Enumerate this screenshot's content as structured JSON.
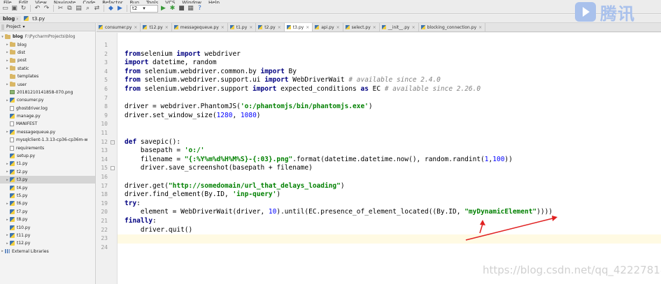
{
  "menu": [
    "File",
    "Edit",
    "View",
    "Navigate",
    "Code",
    "Refactor",
    "Run",
    "Tools",
    "VCS",
    "Window",
    "Help"
  ],
  "toolbar": {
    "run_config": "t2",
    "icons": [
      "folder-open-icon",
      "save-icon",
      "refresh-icon",
      "undo-icon",
      "redo-icon",
      "cut-icon",
      "copy-icon",
      "paste-icon",
      "find-icon",
      "replace-icon",
      "back-icon",
      "forward-icon",
      "run-icon",
      "debug-icon",
      "stop-icon",
      "sdk-icon",
      "help-icon"
    ]
  },
  "nav": {
    "project": "blog",
    "file": "t3.py"
  },
  "project_panel": {
    "title": "Project",
    "root_name": "blog",
    "root_path": "F:\\PycharmProjects\\blog",
    "items": [
      {
        "label": "blog",
        "type": "folder",
        "expandable": true
      },
      {
        "label": "dist",
        "type": "folder",
        "expandable": true
      },
      {
        "label": "post",
        "type": "folder",
        "expandable": true
      },
      {
        "label": "static",
        "type": "folder",
        "expandable": true
      },
      {
        "label": "templates",
        "type": "folder",
        "expandable": false
      },
      {
        "label": "user",
        "type": "folder",
        "expandable": true
      },
      {
        "label": "20181210141858-070.png",
        "type": "image",
        "expandable": false
      },
      {
        "label": "consumer.py",
        "type": "py",
        "expandable": true
      },
      {
        "label": "ghostdriver.log",
        "type": "file",
        "expandable": false
      },
      {
        "label": "manage.py",
        "type": "py",
        "expandable": false
      },
      {
        "label": "MANIFEST",
        "type": "file",
        "expandable": false
      },
      {
        "label": "messagequeue.py",
        "type": "py",
        "expandable": true
      },
      {
        "label": "mysqlclient-1.3.13-cp36-cp36m-w",
        "type": "file",
        "expandable": false
      },
      {
        "label": "requirements",
        "type": "file",
        "expandable": false
      },
      {
        "label": "setup.py",
        "type": "py",
        "expandable": false
      },
      {
        "label": "t1.py",
        "type": "py",
        "expandable": true
      },
      {
        "label": "t2.py",
        "type": "py",
        "expandable": true
      },
      {
        "label": "t3.py",
        "type": "py",
        "expandable": true,
        "selected": true
      },
      {
        "label": "t4.py",
        "type": "py",
        "expandable": false
      },
      {
        "label": "t5.py",
        "type": "py",
        "expandable": false
      },
      {
        "label": "t6.py",
        "type": "py",
        "expandable": true
      },
      {
        "label": "t7.py",
        "type": "py",
        "expandable": false
      },
      {
        "label": "t8.py",
        "type": "py",
        "expandable": true
      },
      {
        "label": "t10.py",
        "type": "py",
        "expandable": false
      },
      {
        "label": "t11.py",
        "type": "py",
        "expandable": true
      },
      {
        "label": "t12.py",
        "type": "py",
        "expandable": true
      },
      {
        "label": "External Libraries",
        "type": "lib",
        "expandable": true,
        "root": true
      }
    ]
  },
  "tabs": [
    {
      "label": "consumer.py",
      "active": false
    },
    {
      "label": "t12.py",
      "active": false
    },
    {
      "label": "messagequeue.py",
      "active": false
    },
    {
      "label": "t1.py",
      "active": false
    },
    {
      "label": "t2.py",
      "active": false
    },
    {
      "label": "t3.py",
      "active": true
    },
    {
      "label": "api.py",
      "active": false
    },
    {
      "label": "select.py",
      "active": false
    },
    {
      "label": "__init__.py",
      "active": false
    },
    {
      "label": "blocking_connection.py",
      "active": false
    }
  ],
  "editor": {
    "line_numbers": [
      "1",
      "2",
      "3",
      "4",
      "5",
      "6",
      "7",
      "8",
      "9",
      "10",
      "11",
      "12",
      "13",
      "14",
      "15",
      "16",
      "17",
      "18",
      "19",
      "20",
      "21",
      "22",
      "23",
      "24"
    ],
    "current_line": 23,
    "lines": [
      [],
      [
        [
          "kw",
          "from"
        ],
        [
          "",
          "selenium "
        ],
        [
          "kw",
          "import"
        ],
        [
          "",
          " webdriver"
        ]
      ],
      [
        [
          "kw",
          "import"
        ],
        [
          "",
          " datetime, random"
        ]
      ],
      [
        [
          "kw",
          "from"
        ],
        [
          "",
          " selenium.webdriver.common.by "
        ],
        [
          "kw",
          "import"
        ],
        [
          "",
          " By"
        ]
      ],
      [
        [
          "kw",
          "from"
        ],
        [
          "",
          " selenium.webdriver.support.ui "
        ],
        [
          "kw",
          "import"
        ],
        [
          "",
          " WebDriverWait "
        ],
        [
          "cmt",
          "# available since 2.4.0"
        ]
      ],
      [
        [
          "kw",
          "from"
        ],
        [
          "",
          " selenium.webdriver.support "
        ],
        [
          "kw",
          "import"
        ],
        [
          "",
          " expected_conditions "
        ],
        [
          "kw",
          "as"
        ],
        [
          "",
          " EC "
        ],
        [
          "cmt",
          "# available since 2.26.0"
        ]
      ],
      [],
      [
        [
          "",
          "driver = webdriver.PhantomJS("
        ],
        [
          "str",
          "'o:/phantomjs/bin/phantomjs.exe'"
        ],
        [
          "",
          ")"
        ]
      ],
      [
        [
          "",
          "driver.set_window_size("
        ],
        [
          "num",
          "1280"
        ],
        [
          "",
          ", "
        ],
        [
          "num",
          "1080"
        ],
        [
          "",
          ")"
        ]
      ],
      [],
      [],
      [
        [
          "kw",
          "def"
        ],
        [
          "",
          " savepic():"
        ]
      ],
      [
        [
          "",
          "    basepath = "
        ],
        [
          "str",
          "'o:/'"
        ]
      ],
      [
        [
          "",
          "    filename = "
        ],
        [
          "str",
          "\"{:%Y%m%d%H%M%S}-{:03}.png\""
        ],
        [
          "",
          ".format(datetime.datetime.now(), random.randint("
        ],
        [
          "num",
          "1"
        ],
        [
          "",
          ","
        ],
        [
          "num",
          "100"
        ],
        [
          "",
          "))"
        ]
      ],
      [
        [
          "",
          "    driver.save_screenshot(basepath + filename)"
        ]
      ],
      [],
      [
        [
          "",
          "driver.get("
        ],
        [
          "str",
          "\"http://somedomain/url_that_delays_loading\""
        ],
        [
          "",
          ")"
        ]
      ],
      [
        [
          "",
          "driver.find_element(By.ID, "
        ],
        [
          "str",
          "'inp-query'"
        ],
        [
          "",
          ")"
        ]
      ],
      [
        [
          "kw",
          "try"
        ],
        [
          "",
          ":"
        ]
      ],
      [
        [
          "",
          "    element = WebDriverWait(driver, "
        ],
        [
          "num",
          "10"
        ],
        [
          "",
          ").until(EC.presence_of_element_located((By.ID, "
        ],
        [
          "str",
          "\"myDynamicElement\""
        ],
        [
          "",
          "))))"
        ]
      ],
      [
        [
          "kw",
          "finally"
        ],
        [
          "",
          ":"
        ]
      ],
      [
        [
          "",
          "    driver.quit()"
        ]
      ],
      [],
      []
    ]
  },
  "watermark": "https://blog.csdn.net/qq_42227818",
  "brand_text": "腾讯"
}
